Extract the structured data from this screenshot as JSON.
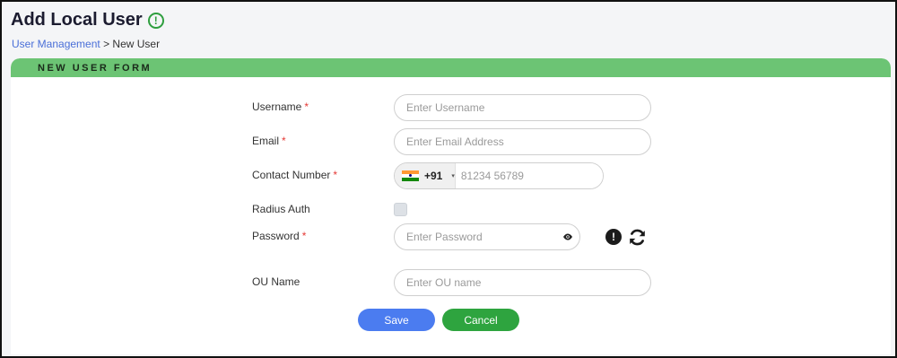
{
  "page": {
    "title": "Add Local User",
    "title_icon": "info-circle-icon"
  },
  "breadcrumb": {
    "parent": "User Management",
    "separator": ">",
    "current": "New User"
  },
  "form": {
    "header": "NEW USER FORM",
    "required_mark": "*",
    "username": {
      "label": "Username",
      "placeholder": "Enter Username",
      "value": ""
    },
    "email": {
      "label": "Email",
      "placeholder": "Enter Email Address",
      "value": ""
    },
    "contact": {
      "label": "Contact Number",
      "country_flag": "india-flag-icon",
      "dial_code": "+91",
      "caret": "▾",
      "placeholder": "81234 56789",
      "value": ""
    },
    "radius_auth": {
      "label": "Radius Auth",
      "checked": false
    },
    "password": {
      "label": "Password",
      "placeholder": "Enter Password",
      "value": "",
      "toggle_icon": "eye-icon",
      "info_icon": "exclamation-icon",
      "generate_icon": "refresh-icon"
    },
    "ou_name": {
      "label": "OU Name",
      "placeholder": "Enter OU name",
      "value": ""
    }
  },
  "buttons": {
    "save": "Save",
    "cancel": "Cancel"
  },
  "colors": {
    "header_green": "#6cc474",
    "save_blue": "#4b7cf0",
    "cancel_green": "#2ea43f",
    "link_blue": "#4a6fd8",
    "required_red": "#e53935"
  }
}
